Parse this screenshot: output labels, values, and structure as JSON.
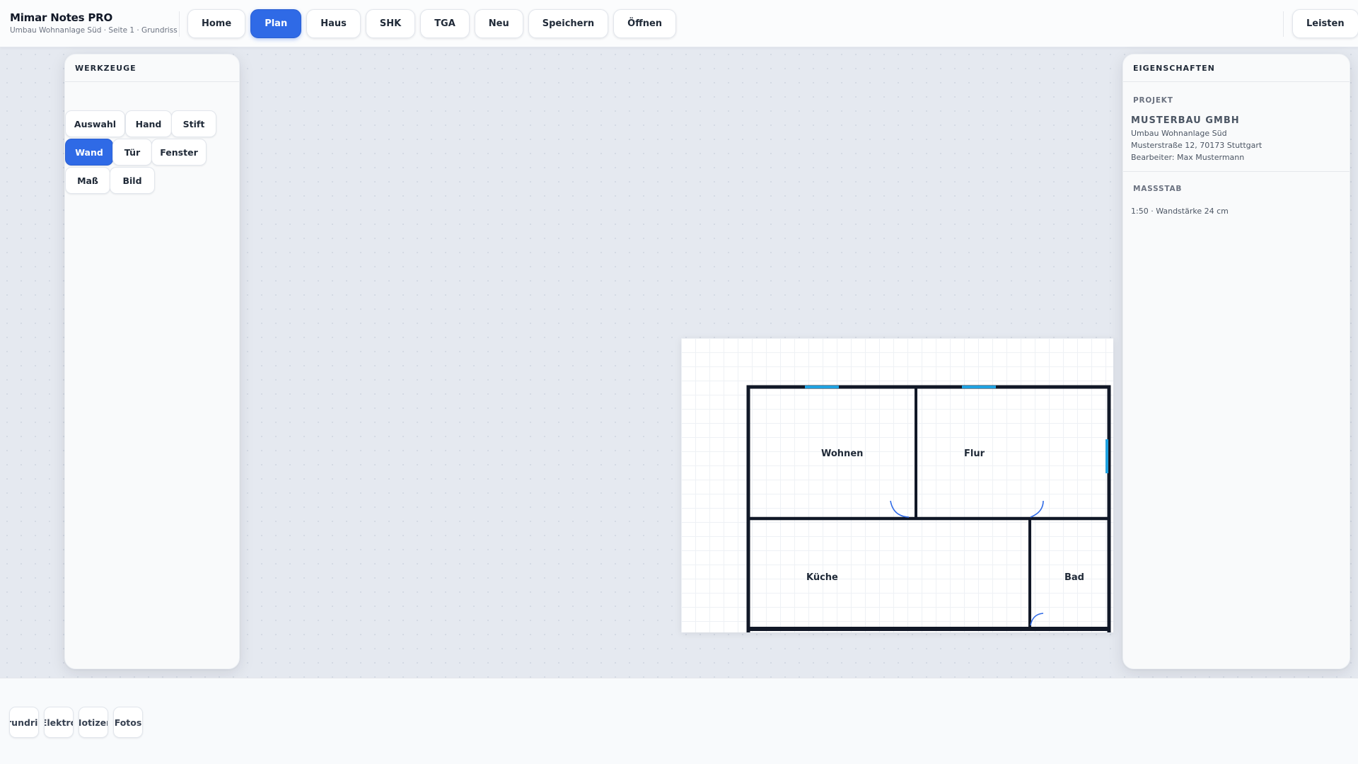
{
  "app": {
    "title": "Mimar Notes PRO",
    "subtitle": "Umbau Wohnanlage Süd · Seite 1 · Grundriss"
  },
  "nav": {
    "items": [
      {
        "label": "Home",
        "active": false
      },
      {
        "label": "Plan",
        "active": true
      },
      {
        "label": "Haus",
        "active": false
      },
      {
        "label": "SHK",
        "active": false
      },
      {
        "label": "TGA",
        "active": false
      },
      {
        "label": "Neu",
        "active": false
      },
      {
        "label": "Speichern",
        "active": false
      },
      {
        "label": "Öffnen",
        "active": false
      }
    ],
    "right_label": "Leisten"
  },
  "tools": {
    "heading": "WERKZEUGE",
    "items": [
      {
        "label": "Auswahl",
        "active": false
      },
      {
        "label": "Hand",
        "active": false
      },
      {
        "label": "Stift",
        "active": false
      },
      {
        "label": "Wand",
        "active": true
      },
      {
        "label": "Tür",
        "active": false
      },
      {
        "label": "Fenster",
        "active": false
      },
      {
        "label": "Maß",
        "active": false
      },
      {
        "label": "Bild",
        "active": false
      }
    ]
  },
  "properties": {
    "heading": "EIGENSCHAFTEN",
    "project": {
      "heading": "PROJEKT",
      "company": "MUSTERBAU GMBH",
      "project_name": "Umbau Wohnanlage Süd",
      "address": "Musterstraße 12, 70173 Stuttgart",
      "editor": "Bearbeiter: Max Mustermann"
    },
    "scale": {
      "heading": "MASSSTAB",
      "value": "1:50 · Wandstärke 24 cm"
    }
  },
  "plan": {
    "rooms": {
      "wohnen": "Wohnen",
      "flur": "Flur",
      "kueche": "Küche",
      "bad": "Bad"
    },
    "colors": {
      "wall": "#111827",
      "window": "#1ea1e0",
      "door": "#2f6ae6"
    }
  },
  "pages": {
    "tabs": [
      {
        "label": "Grundriss"
      },
      {
        "label": "Elektro"
      },
      {
        "label": "Notizen"
      },
      {
        "label": "Fotos"
      }
    ]
  }
}
